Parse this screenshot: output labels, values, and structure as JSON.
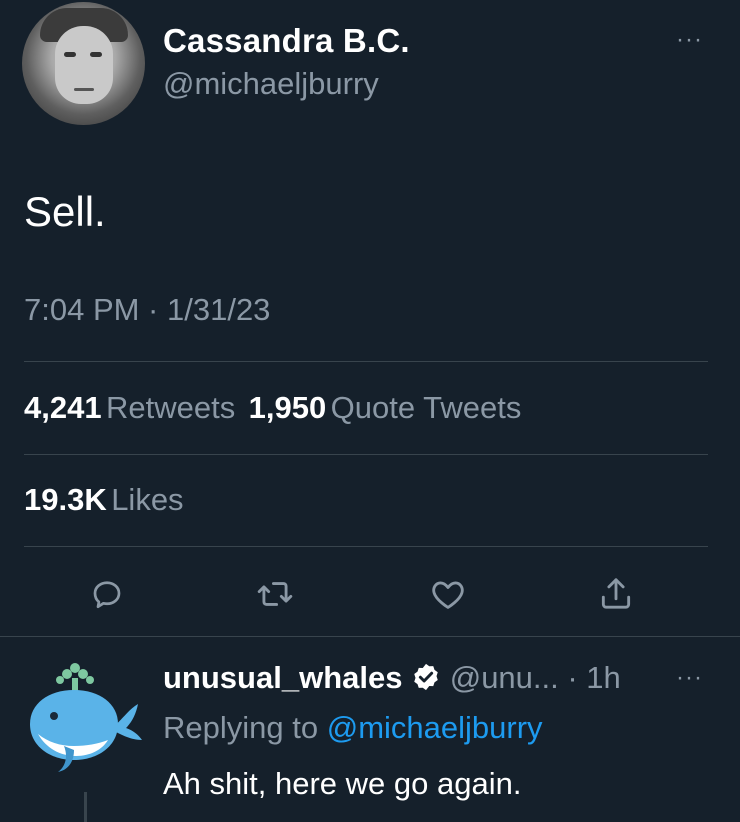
{
  "tweet": {
    "author_name": "Cassandra B.C.",
    "author_handle": "@michaeljburry",
    "more_label": "···",
    "text": "Sell.",
    "timestamp": "7:04 PM · 1/31/23"
  },
  "stats": {
    "retweets_count": "4,241",
    "retweets_label": "Retweets",
    "quotes_count": "1,950",
    "quotes_label": "Quote Tweets",
    "likes_count": "19.3K",
    "likes_label": "Likes"
  },
  "actions": [
    {
      "icon": "reply-icon"
    },
    {
      "icon": "retweet-icon"
    },
    {
      "icon": "like-icon"
    },
    {
      "icon": "share-icon"
    }
  ],
  "reply": {
    "author_name": "unusual_whales",
    "verified_icon": "verified-badge-icon",
    "author_handle": "@unu...",
    "time": "· 1h",
    "more_label": "···",
    "replying_prefix": "Replying to",
    "replying_to": "@michaeljburry",
    "text": "Ah shit, here we go again."
  },
  "colors": {
    "background": "#15202b",
    "secondary_text": "#8b98a5",
    "link": "#1d9bf0",
    "divider": "#38444d"
  }
}
